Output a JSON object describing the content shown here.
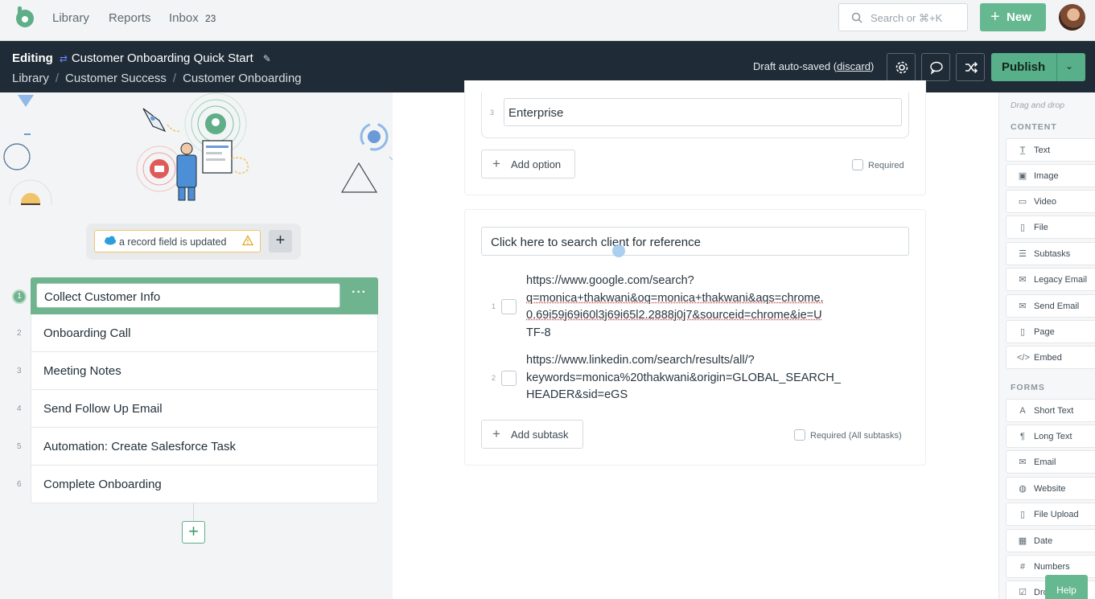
{
  "topnav": {
    "links": [
      "Library",
      "Reports",
      "Inbox"
    ],
    "inbox_count": "23",
    "search_placeholder": "Search or ⌘+K",
    "new_label": "New"
  },
  "editbar": {
    "mode": "Editing",
    "title": "Customer Onboarding Quick Start",
    "breadcrumb": [
      "Library",
      "Customer Success",
      "Customer Onboarding"
    ],
    "draft_text": "Draft auto-saved",
    "discard": "discard",
    "publish_label": "Publish"
  },
  "trigger": {
    "label": "a record field is updated"
  },
  "tasks": [
    {
      "num": "1",
      "label": "Collect Customer Info"
    },
    {
      "num": "2",
      "label": "Onboarding Call"
    },
    {
      "num": "3",
      "label": "Meeting Notes"
    },
    {
      "num": "4",
      "label": "Send Follow Up Email"
    },
    {
      "num": "5",
      "label": "Automation: Create Salesforce Task"
    },
    {
      "num": "6",
      "label": "Complete Onboarding"
    }
  ],
  "editor": {
    "option_number": "3",
    "option_value": "Enterprise",
    "add_option": "Add option",
    "required": "Required",
    "subtasks_field": "Click here to search client for reference",
    "subtasks": [
      {
        "num": "1",
        "lines": [
          "https://www.google.com/search?",
          "q=monica+thakwani&oq=monica+thakwani&aqs=chrome.",
          "0.69i59j69i60l3j69i65l2.2888j0j7&sourceid=chrome&ie=U",
          "TF-8"
        ]
      },
      {
        "num": "2",
        "lines": [
          "https://www.linkedin.com/search/results/all/?",
          "keywords=monica%20thakwani&origin=GLOBAL_SEARCH_",
          "HEADER&sid=eGS"
        ]
      }
    ],
    "add_subtask": "Add subtask",
    "required_all": "Required (All subtasks)"
  },
  "sidebar": {
    "hint": "Drag and drop",
    "content_title": "CONTENT",
    "content_items": [
      {
        "label": "Text",
        "icon": "text-icon"
      },
      {
        "label": "Image",
        "icon": "image-icon"
      },
      {
        "label": "Video",
        "icon": "video-icon"
      },
      {
        "label": "File",
        "icon": "file-icon"
      },
      {
        "label": "Subtasks",
        "icon": "list-icon"
      },
      {
        "label": "Legacy Email",
        "icon": "email-icon"
      },
      {
        "label": "Send Email",
        "icon": "email-icon"
      },
      {
        "label": "Page",
        "icon": "page-icon"
      },
      {
        "label": "Embed",
        "icon": "code-icon"
      }
    ],
    "forms_title": "FORMS",
    "form_items": [
      {
        "label": "Short Text",
        "icon": "short-text-icon"
      },
      {
        "label": "Long Text",
        "icon": "paragraph-icon"
      },
      {
        "label": "Email",
        "icon": "email-icon"
      },
      {
        "label": "Website",
        "icon": "globe-icon"
      },
      {
        "label": "File Upload",
        "icon": "upload-icon"
      },
      {
        "label": "Date",
        "icon": "calendar-icon"
      },
      {
        "label": "Numbers",
        "icon": "hash-icon"
      },
      {
        "label": "Dro",
        "icon": "dropdown-icon"
      }
    ]
  },
  "help_label": "Help"
}
